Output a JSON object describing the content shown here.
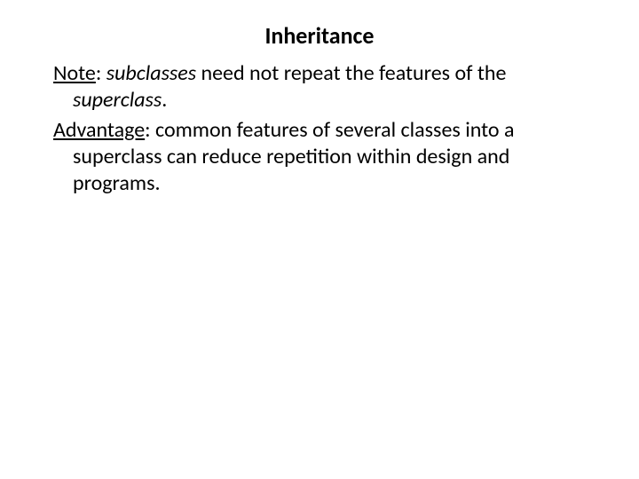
{
  "title": "Inheritance",
  "note": {
    "label": "Note",
    "colon": ": ",
    "italic1": "subclasses",
    "plain1": " need not repeat the features of the ",
    "italic2": "superclass",
    "plain2": "."
  },
  "advantage": {
    "label": "Advantage",
    "colon": ": ",
    "text": "common features of several classes into a superclass can reduce repetition within design and programs."
  }
}
